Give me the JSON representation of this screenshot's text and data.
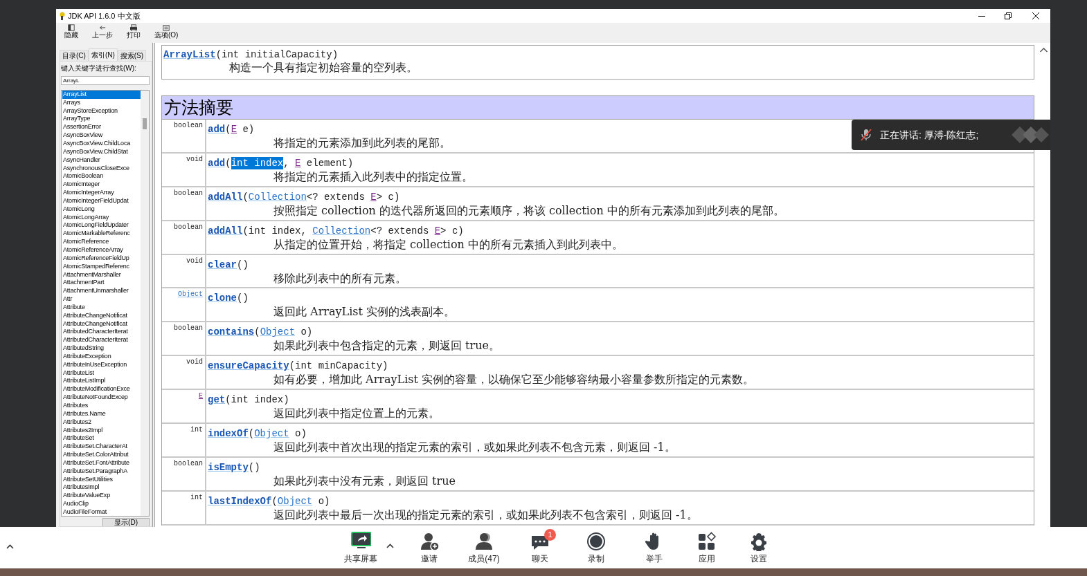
{
  "window": {
    "title": "JDK API 1.6.0 中文版"
  },
  "toolbar": [
    {
      "label": "隐藏",
      "kind": "hide"
    },
    {
      "label": "上一步",
      "kind": "back"
    },
    {
      "label": "打印",
      "kind": "print"
    },
    {
      "label": "选项(O)",
      "kind": "options"
    }
  ],
  "sidebar": {
    "tabs": [
      {
        "label": "目录(C)",
        "selected": false
      },
      {
        "label": "索引(N)",
        "selected": true
      },
      {
        "label": "搜索(S)",
        "selected": false
      }
    ],
    "search_label": "键入关键字进行查找(W):",
    "search": {
      "value": "ArrayL"
    },
    "items": [
      {
        "label": "ArrayList",
        "selected": true
      },
      {
        "label": "Arrays",
        "selected": false
      },
      {
        "label": "ArrayStoreException",
        "selected": false
      },
      {
        "label": "ArrayType",
        "selected": false
      },
      {
        "label": "AssertionError",
        "selected": false
      },
      {
        "label": "AsyncBoxView",
        "selected": false
      },
      {
        "label": "AsyncBoxView.ChildLoca",
        "selected": false
      },
      {
        "label": "AsyncBoxView.ChildStat",
        "selected": false
      },
      {
        "label": "AsyncHandler",
        "selected": false
      },
      {
        "label": "AsynchronousCloseExce",
        "selected": false
      },
      {
        "label": "AtomicBoolean",
        "selected": false
      },
      {
        "label": "AtomicInteger",
        "selected": false
      },
      {
        "label": "AtomicIntegerArray",
        "selected": false
      },
      {
        "label": "AtomicIntegerFieldUpdat",
        "selected": false
      },
      {
        "label": "AtomicLong",
        "selected": false
      },
      {
        "label": "AtomicLongArray",
        "selected": false
      },
      {
        "label": "AtomicLongFieldUpdater",
        "selected": false
      },
      {
        "label": "AtomicMarkableReferenc",
        "selected": false
      },
      {
        "label": "AtomicReference",
        "selected": false
      },
      {
        "label": "AtomicReferenceArray",
        "selected": false
      },
      {
        "label": "AtomicReferenceFieldUp",
        "selected": false
      },
      {
        "label": "AtomicStampedReferenc",
        "selected": false
      },
      {
        "label": "AttachmentMarshaller",
        "selected": false
      },
      {
        "label": "AttachmentPart",
        "selected": false
      },
      {
        "label": "AttachmentUnmarshaller",
        "selected": false
      },
      {
        "label": "Attr",
        "selected": false
      },
      {
        "label": "Attribute",
        "selected": false
      },
      {
        "label": "AttributeChangeNotificat",
        "selected": false
      },
      {
        "label": "AttributeChangeNotificat",
        "selected": false
      },
      {
        "label": "AttributedCharacterIterat",
        "selected": false
      },
      {
        "label": "AttributedCharacterIterat",
        "selected": false
      },
      {
        "label": "AttributedString",
        "selected": false
      },
      {
        "label": "AttributeException",
        "selected": false
      },
      {
        "label": "AttributeInUseException",
        "selected": false
      },
      {
        "label": "AttributeList",
        "selected": false
      },
      {
        "label": "AttributeListImpl",
        "selected": false
      },
      {
        "label": "AttributeModificationExce",
        "selected": false
      },
      {
        "label": "AttributeNotFoundExcep",
        "selected": false
      },
      {
        "label": "Attributes",
        "selected": false
      },
      {
        "label": "Attributes.Name",
        "selected": false
      },
      {
        "label": "Attributes2",
        "selected": false
      },
      {
        "label": "Attributes2Impl",
        "selected": false
      },
      {
        "label": "AttributeSet",
        "selected": false
      },
      {
        "label": "AttributeSet.CharacterAt",
        "selected": false
      },
      {
        "label": "AttributeSet.ColorAttribut",
        "selected": false
      },
      {
        "label": "AttributeSet.FontAttribute",
        "selected": false
      },
      {
        "label": "AttributeSet.ParagraphA",
        "selected": false
      },
      {
        "label": "AttributeSetUtilities",
        "selected": false
      },
      {
        "label": "AttributesImpl",
        "selected": false
      },
      {
        "label": "AttributeValueExp",
        "selected": false
      },
      {
        "label": "AudioClip",
        "selected": false
      },
      {
        "label": "AudioFileFormat",
        "selected": false
      }
    ],
    "button": "显示(D)"
  },
  "constructor": {
    "signature": [
      {
        "kind": "method",
        "text": "ArrayList"
      },
      {
        "kind": "plain",
        "text": "(int initialCapacity)"
      }
    ],
    "description": "构造一个具有指定初始容量的空列表。"
  },
  "method_summary": {
    "title": "方法摘要",
    "rows": [
      {
        "returns": [
          {
            "kind": "plain",
            "text": "boolean"
          }
        ],
        "signature": [
          {
            "kind": "method",
            "text": "add"
          },
          {
            "kind": "plain",
            "text": "("
          },
          {
            "kind": "typevar",
            "text": "E"
          },
          {
            "kind": "plain",
            "text": " e)"
          }
        ],
        "description": "将指定的元素添加到此列表的尾部。"
      },
      {
        "returns": [
          {
            "kind": "plain",
            "text": "void"
          }
        ],
        "signature": [
          {
            "kind": "method",
            "text": "add"
          },
          {
            "kind": "plain",
            "text": "("
          },
          {
            "kind": "highlight",
            "text": "int index"
          },
          {
            "kind": "plain",
            "text": ", "
          },
          {
            "kind": "typevar",
            "text": "E"
          },
          {
            "kind": "plain",
            "text": " element)"
          }
        ],
        "description": "将指定的元素插入此列表中的指定位置。"
      },
      {
        "returns": [
          {
            "kind": "plain",
            "text": "boolean"
          }
        ],
        "signature": [
          {
            "kind": "method",
            "text": "addAll"
          },
          {
            "kind": "plain",
            "text": "("
          },
          {
            "kind": "link",
            "text": "Collection"
          },
          {
            "kind": "plain",
            "text": "<? extends "
          },
          {
            "kind": "typevar",
            "text": "E"
          },
          {
            "kind": "plain",
            "text": "> c)"
          }
        ],
        "description": "按照指定 collection 的迭代器所返回的元素顺序，将该 collection 中的所有元素添加到此列表的尾部。"
      },
      {
        "returns": [
          {
            "kind": "plain",
            "text": "boolean"
          }
        ],
        "signature": [
          {
            "kind": "method",
            "text": "addAll"
          },
          {
            "kind": "plain",
            "text": "(int index, "
          },
          {
            "kind": "link",
            "text": "Collection"
          },
          {
            "kind": "plain",
            "text": "<? extends "
          },
          {
            "kind": "typevar",
            "text": "E"
          },
          {
            "kind": "plain",
            "text": "> c)"
          }
        ],
        "description": "从指定的位置开始，将指定 collection 中的所有元素插入到此列表中。"
      },
      {
        "returns": [
          {
            "kind": "plain",
            "text": "void"
          }
        ],
        "signature": [
          {
            "kind": "method",
            "text": "clear"
          },
          {
            "kind": "plain",
            "text": "()"
          }
        ],
        "description": "移除此列表中的所有元素。"
      },
      {
        "returns": [
          {
            "kind": "link",
            "text": "Object"
          }
        ],
        "signature": [
          {
            "kind": "method",
            "text": "clone"
          },
          {
            "kind": "plain",
            "text": "()"
          }
        ],
        "description": "返回此 ArrayList 实例的浅表副本。"
      },
      {
        "returns": [
          {
            "kind": "plain",
            "text": "boolean"
          }
        ],
        "signature": [
          {
            "kind": "method",
            "text": "contains"
          },
          {
            "kind": "plain",
            "text": "("
          },
          {
            "kind": "link",
            "text": "Object"
          },
          {
            "kind": "plain",
            "text": " o)"
          }
        ],
        "description": "如果此列表中包含指定的元素，则返回 true。"
      },
      {
        "returns": [
          {
            "kind": "plain",
            "text": "void"
          }
        ],
        "signature": [
          {
            "kind": "method",
            "text": "ensureCapacity"
          },
          {
            "kind": "plain",
            "text": "(int minCapacity)"
          }
        ],
        "description": "如有必要，增加此 ArrayList 实例的容量，以确保它至少能够容纳最小容量参数所指定的元素数。"
      },
      {
        "returns": [
          {
            "kind": "typevar",
            "text": "E"
          }
        ],
        "signature": [
          {
            "kind": "method",
            "text": "get"
          },
          {
            "kind": "plain",
            "text": "(int index)"
          }
        ],
        "description": "返回此列表中指定位置上的元素。"
      },
      {
        "returns": [
          {
            "kind": "plain",
            "text": "int"
          }
        ],
        "signature": [
          {
            "kind": "method",
            "text": "indexOf"
          },
          {
            "kind": "plain",
            "text": "("
          },
          {
            "kind": "link",
            "text": "Object"
          },
          {
            "kind": "plain",
            "text": " o)"
          }
        ],
        "description": "返回此列表中首次出现的指定元素的索引，或如果此列表不包含元素，则返回 -1。"
      },
      {
        "returns": [
          {
            "kind": "plain",
            "text": "boolean"
          }
        ],
        "signature": [
          {
            "kind": "method",
            "text": "isEmpty"
          },
          {
            "kind": "plain",
            "text": "()"
          }
        ],
        "description": "如果此列表中没有元素，则返回 true"
      },
      {
        "returns": [
          {
            "kind": "plain",
            "text": "int"
          }
        ],
        "signature": [
          {
            "kind": "method",
            "text": "lastIndexOf"
          },
          {
            "kind": "plain",
            "text": "("
          },
          {
            "kind": "link",
            "text": "Object"
          },
          {
            "kind": "plain",
            "text": " o)"
          }
        ],
        "description": "返回此列表中最后一次出现的指定元素的索引，或如果此列表不包含索引，则返回 -1。"
      }
    ]
  },
  "speaker_banner": {
    "text": "正在讲话: 厚溥-陈红志;"
  },
  "meeting_toolbar": [
    {
      "kind": "share",
      "label": "共享屏幕"
    },
    {
      "kind": "invite",
      "label": "邀请"
    },
    {
      "kind": "members",
      "label": "成员(47)"
    },
    {
      "kind": "chat",
      "label": "聊天",
      "badge": "1"
    },
    {
      "kind": "record",
      "label": "录制"
    },
    {
      "kind": "hand",
      "label": "举手"
    },
    {
      "kind": "apps",
      "label": "应用"
    },
    {
      "kind": "settings",
      "label": "设置"
    }
  ]
}
